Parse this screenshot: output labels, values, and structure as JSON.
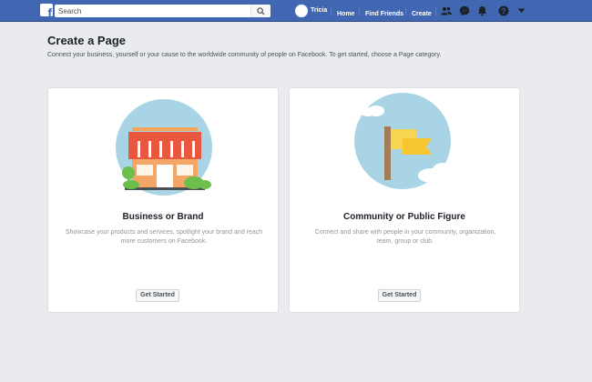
{
  "topbar": {
    "logo_letter": "f",
    "search": {
      "placeholder": "Search",
      "value": ""
    },
    "profile_name": "Tricia",
    "links": {
      "home": "Home",
      "find_friends": "Find Friends",
      "create": "Create"
    },
    "colors": {
      "bar": "#4267b2",
      "text": "#ffffff"
    }
  },
  "page": {
    "title": "Create a Page",
    "subtitle": "Connect your business, yourself or your cause to the worldwide community of people on Facebook. To get started, choose a Page category."
  },
  "cards": [
    {
      "title": "Business or Brand",
      "description": "Showcase your products and services, spotlight your brand and reach more customers on Facebook.",
      "button": "Get Started",
      "illustration": "storefront-icon"
    },
    {
      "title": "Community or Public Figure",
      "description": "Connect and share with people in your community, organization, team, group or club.",
      "button": "Get Started",
      "illustration": "flag-icon"
    }
  ]
}
